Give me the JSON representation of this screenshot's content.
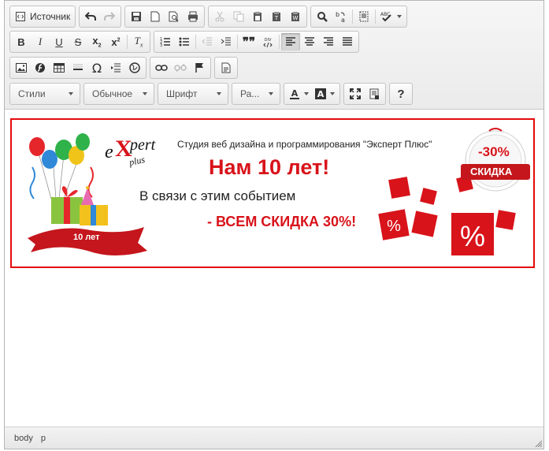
{
  "toolbar": {
    "source_label": "Источник",
    "styles_label": "Стили",
    "format_label": "Обычное",
    "font_label": "Шрифт",
    "size_label": "Ра..."
  },
  "banner": {
    "studio_text": "Студия веб дизайна и программирования \"Эксперт Плюс\"",
    "headline": "Нам 10 лет!",
    "subline": "В связи с этим событием",
    "offer": "- ВСЕМ СКИДКА 30%!",
    "ribbon_label": "10 лет",
    "badge_percent": "-30%",
    "badge_label": "СКИДКА",
    "logo_text": "expert plus",
    "accent_color": "#d8131a"
  },
  "statusbar": {
    "path": [
      "body",
      "p"
    ]
  }
}
